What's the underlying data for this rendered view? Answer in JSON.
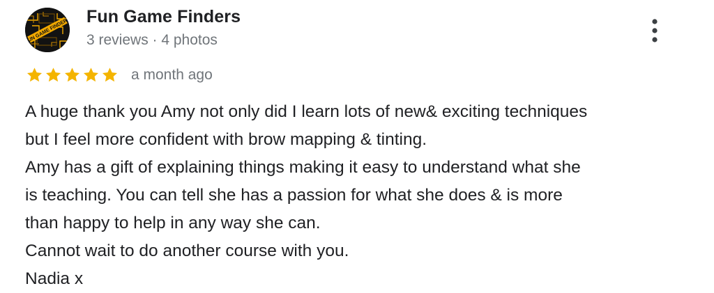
{
  "review": {
    "reviewer": {
      "name": "Fun Game Finders",
      "meta": "3 reviews · 4 photos",
      "avatar_icon": "fun-game-finders-logo",
      "avatar_logo_text": "FUN GAME FINDERS",
      "avatar_colors": {
        "background": "#121212",
        "accent": "#f2a900"
      }
    },
    "rating": {
      "stars": 5,
      "max_stars": 5,
      "star_color": "#f4b400",
      "time": "a month ago"
    },
    "menu_icon": "more-vert-icon",
    "body_lines": [
      "A huge thank you Amy not only did I learn lots of new& exciting techniques",
      "but I feel more confident with brow mapping & tinting.",
      "Amy has a gift of explaining things making it easy to understand what she",
      "is teaching. You can tell she has a passion for what she does & is more",
      "than happy to help in any way she can.",
      "Cannot wait to do another course with you.",
      "Nadia x"
    ]
  }
}
